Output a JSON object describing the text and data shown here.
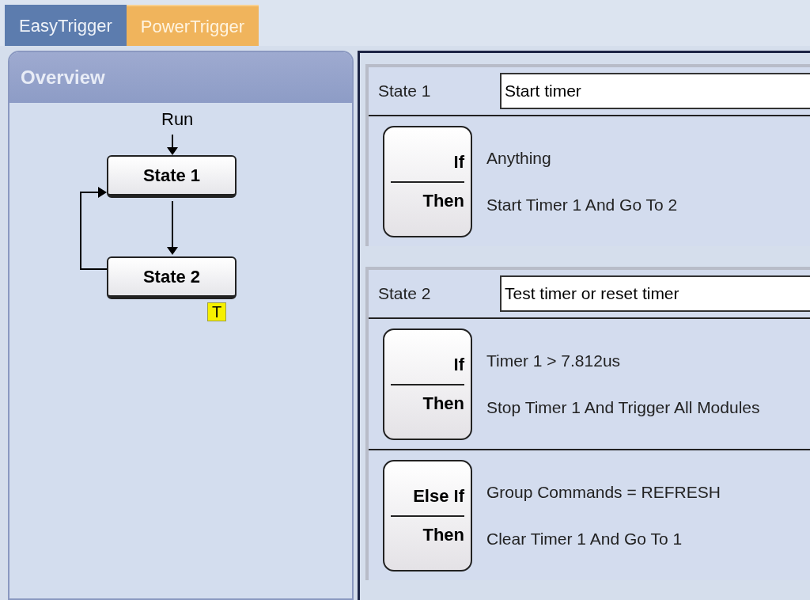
{
  "tabs": [
    {
      "label": "EasyTrigger",
      "selected": false
    },
    {
      "label": "PowerTrigger",
      "selected": true
    }
  ],
  "overview": {
    "title": "Overview",
    "entry_label": "Run",
    "states": [
      {
        "label": "State 1"
      },
      {
        "label": "State 2",
        "badge": "T"
      }
    ]
  },
  "states": [
    {
      "label": "State 1",
      "description": "Start timer",
      "rules": [
        {
          "condition_keyword": "If",
          "action_keyword": "Then",
          "condition": "Anything",
          "action": "Start Timer 1 And Go To 2"
        }
      ]
    },
    {
      "label": "State 2",
      "description": "Test timer or reset timer",
      "rules": [
        {
          "condition_keyword": "If",
          "action_keyword": "Then",
          "condition": "Timer 1 > 7.812us",
          "action": "Stop Timer 1 And Trigger All Modules"
        },
        {
          "condition_keyword": "Else If",
          "action_keyword": "Then",
          "condition": "Group Commands = REFRESH",
          "action": "Clear Timer 1 And Go To 1"
        }
      ]
    }
  ]
}
